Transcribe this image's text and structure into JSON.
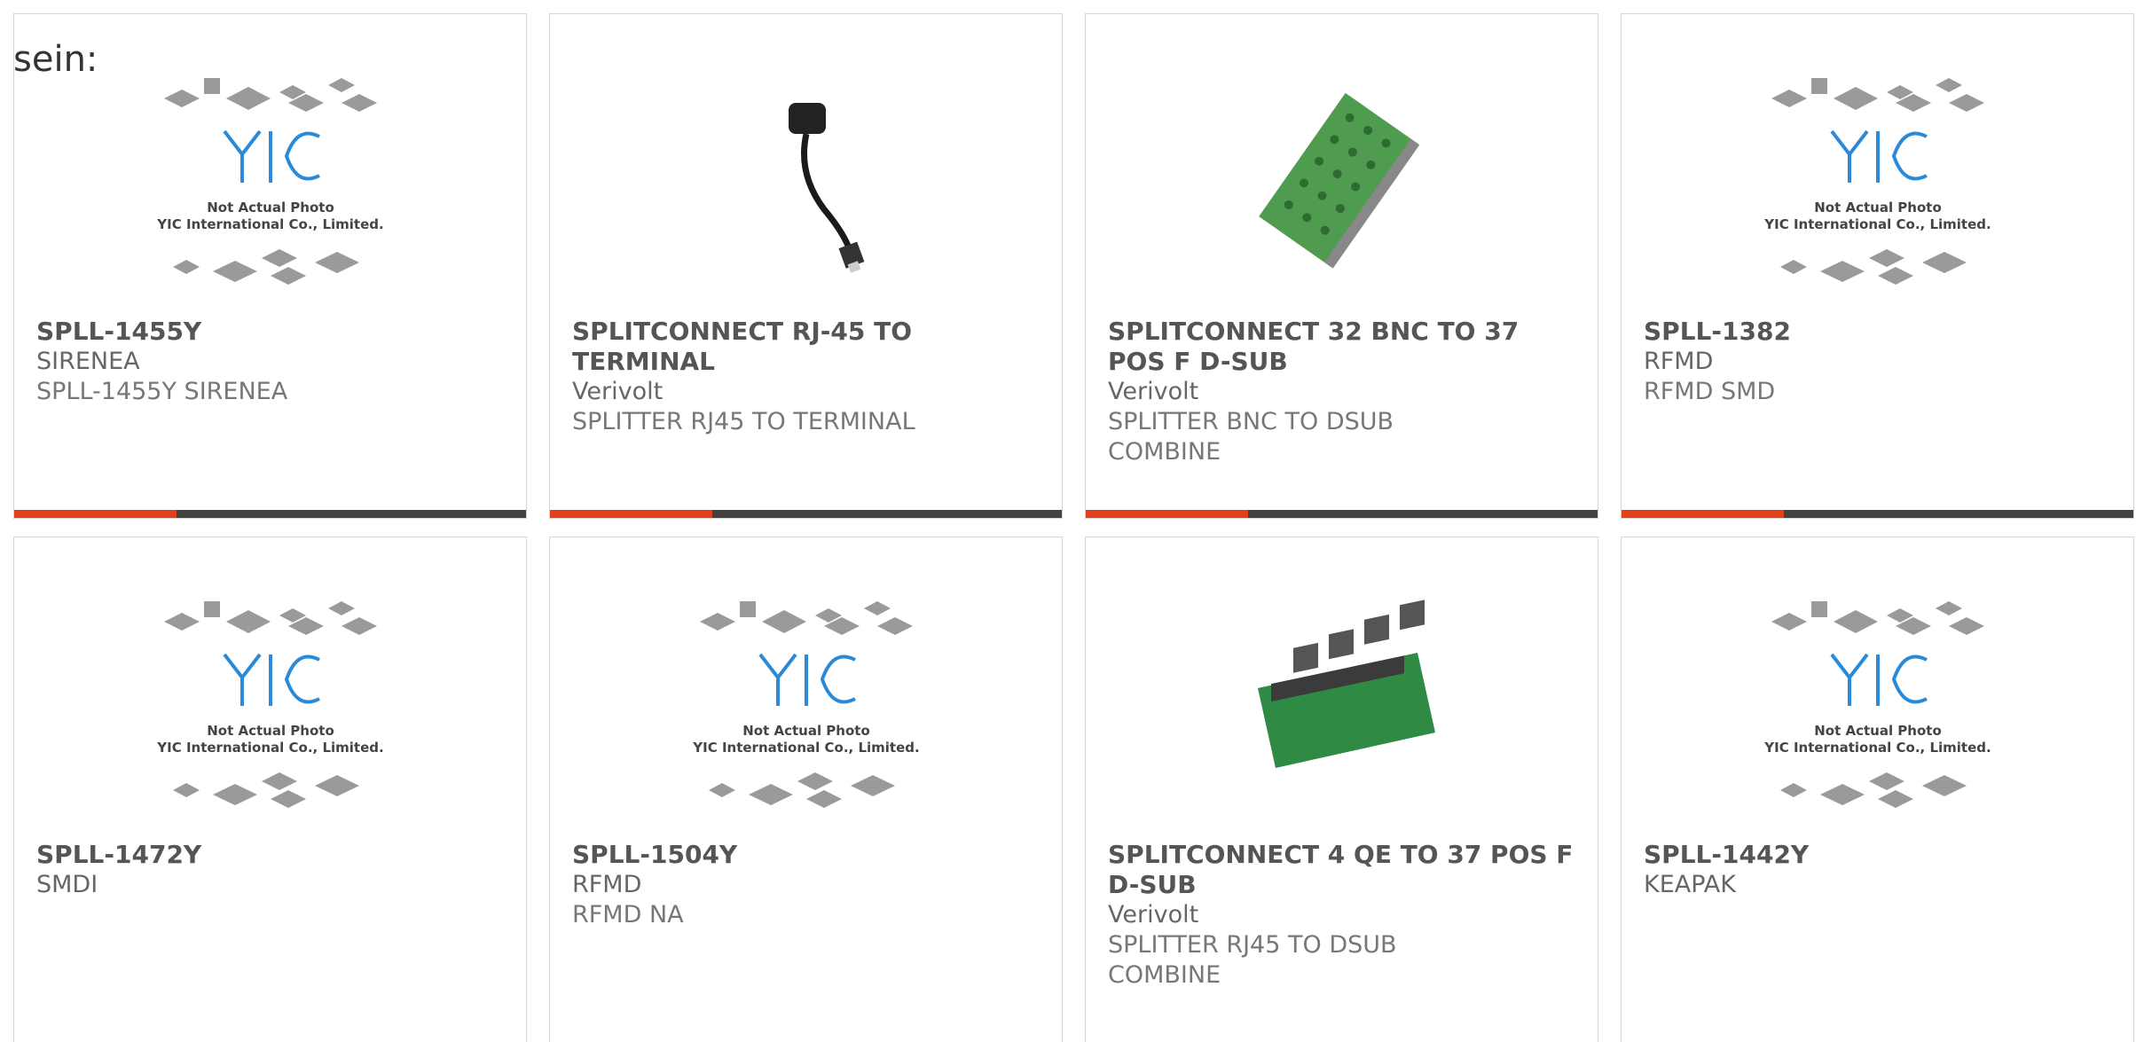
{
  "intro_text": "sein:",
  "colors": {
    "accent": "#e1401b",
    "bar": "#424242",
    "border": "#d6d6d6",
    "logo_blue": "#2a8ad8"
  },
  "placeholder": {
    "line1": "Not Actual Photo",
    "line2": "YIC International Co., Limited."
  },
  "products": [
    {
      "part": "SPLL-1455Y",
      "maker": "SIRENEA",
      "desc1": "SPLL-1455Y SIRENEA",
      "desc2": "",
      "image": "yic-placeholder-logo"
    },
    {
      "part": "SPLITCONNECT RJ-45 TO TERMINAL",
      "maker": "Verivolt",
      "desc1": "SPLITTER RJ45 TO TERMINAL",
      "desc2": "",
      "image": "rj45-cable-photo"
    },
    {
      "part": "SPLITCONNECT 32 BNC TO 37 POS F D-SUB",
      "maker": "Verivolt",
      "desc1": "SPLITTER BNC TO DSUB",
      "desc2": "COMBINE",
      "image": "bnc-board-photo"
    },
    {
      "part": "SPLL-1382",
      "maker": "RFMD",
      "desc1": "RFMD SMD",
      "desc2": "",
      "image": "yic-placeholder-logo"
    },
    {
      "part": "SPLL-1472Y",
      "maker": "SMDI",
      "desc1": "",
      "desc2": "",
      "image": "yic-placeholder-logo"
    },
    {
      "part": "SPLL-1504Y",
      "maker": "RFMD",
      "desc1": "RFMD NA",
      "desc2": "",
      "image": "yic-placeholder-logo"
    },
    {
      "part": "SPLITCONNECT 4 QE TO 37 POS F D-SUB",
      "maker": "Verivolt",
      "desc1": "SPLITTER RJ45 TO DSUB",
      "desc2": "COMBINE",
      "image": "rj45-board-photo"
    },
    {
      "part": "SPLL-1442Y",
      "maker": "KEAPAK",
      "desc1": "",
      "desc2": "",
      "image": "yic-placeholder-logo"
    }
  ]
}
